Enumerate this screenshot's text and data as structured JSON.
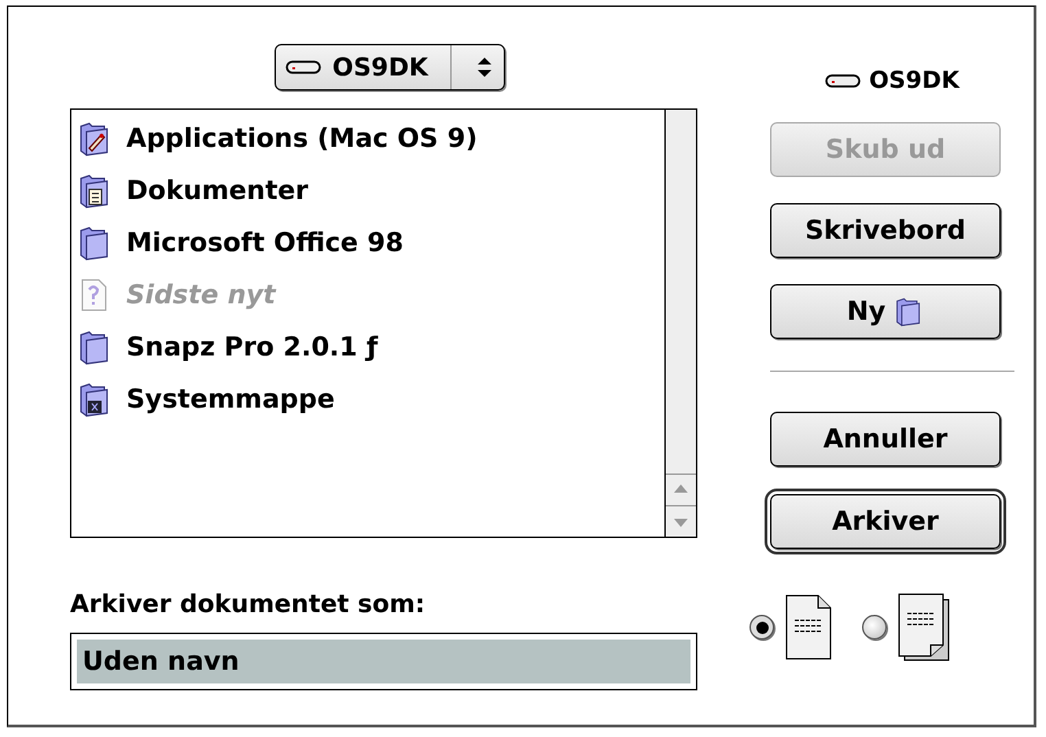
{
  "volume_menu": {
    "label": "OS9DK"
  },
  "files": [
    {
      "name": "Applications (Mac OS 9)",
      "kind": "apps-folder",
      "disabled": false
    },
    {
      "name": "Dokumenter",
      "kind": "documents-folder",
      "disabled": false
    },
    {
      "name": "Microsoft Office 98",
      "kind": "folder",
      "disabled": false
    },
    {
      "name": "Sidste nyt",
      "kind": "unknown",
      "disabled": true
    },
    {
      "name": "Snapz Pro 2.0.1 ƒ",
      "kind": "folder",
      "disabled": false
    },
    {
      "name": "Systemmappe",
      "kind": "system-folder",
      "disabled": false
    }
  ],
  "volume_label": "OS9DK",
  "buttons": [
    {
      "label": "Skub ud",
      "kind": "text",
      "disabled": true,
      "default": false
    },
    {
      "label": "Skrivebord",
      "kind": "text",
      "disabled": false,
      "default": false
    },
    {
      "label": "Ny",
      "kind": "new-folder",
      "disabled": false,
      "default": false
    }
  ],
  "action_buttons": [
    {
      "label": "Annuller",
      "kind": "text",
      "disabled": false,
      "default": false
    },
    {
      "label": "Arkiver",
      "kind": "text",
      "disabled": false,
      "default": true
    }
  ],
  "save_as": {
    "label": "Arkiver dokumentet som:",
    "value": "Uden navn",
    "highlighted": true
  },
  "format_options": [
    {
      "kind": "document",
      "selected": true
    },
    {
      "kind": "stationery",
      "selected": false
    }
  ]
}
